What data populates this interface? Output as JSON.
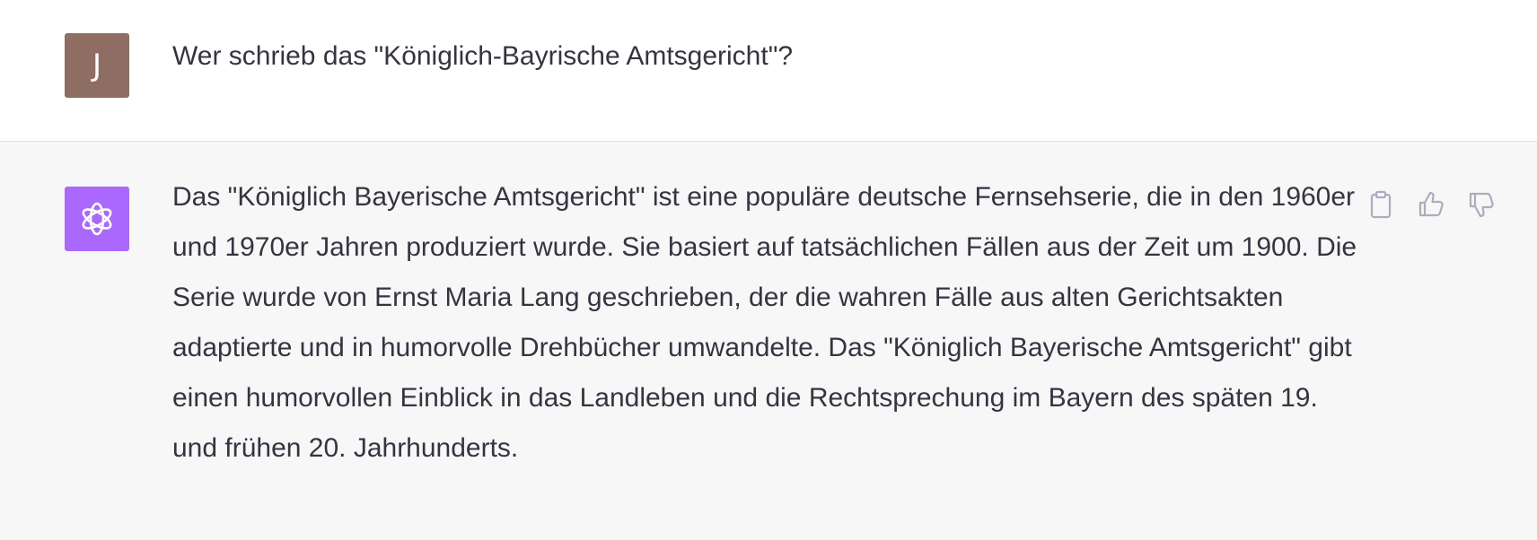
{
  "user": {
    "avatar_initial": "J",
    "avatar_color": "#8e6e63",
    "message": "Wer schrieb das \"Königlich-Bayrische Amtsgericht\"?"
  },
  "assistant": {
    "avatar_icon": "openai-logo-icon",
    "avatar_color": "#ab68ff",
    "message": "Das \"Königlich Bayerische Amtsgericht\" ist eine populäre deutsche Fernsehserie, die in den 1960er und 1970er Jahren produziert wurde. Sie basiert auf tatsächlichen Fällen aus der Zeit um 1900. Die Serie wurde von Ernst Maria Lang geschrieben, der die wahren Fälle aus alten Gerichtsakten adaptierte und in humorvolle Drehbücher umwandelte. Das \"Königlich Bayerische Amtsgericht\" gibt einen humorvollen Einblick in das Landleben und die Rechtsprechung im Bayern des späten 19. und frühen 20. Jahrhunderts.",
    "actions": [
      "clipboard-icon",
      "thumbs-up-icon",
      "thumbs-down-icon"
    ]
  }
}
